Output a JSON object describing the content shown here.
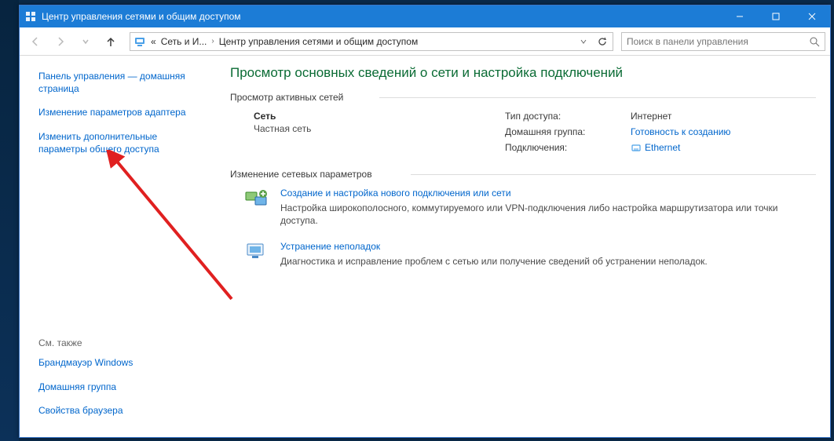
{
  "window": {
    "title": "Центр управления сетями и общим доступом"
  },
  "toolbar": {
    "breadcrumb": {
      "root": "«",
      "part1": "Сеть и И...",
      "part2": "Центр управления сетями и общим доступом"
    },
    "search_placeholder": "Поиск в панели управления"
  },
  "sidebar": {
    "home": "Панель управления — домашняя страница",
    "adapter": "Изменение параметров адаптера",
    "advanced": "Изменить дополнительные параметры общего доступа",
    "see_also": "См. также",
    "firewall": "Брандмауэр Windows",
    "homegroup": "Домашняя группа",
    "browser": "Свойства браузера"
  },
  "content": {
    "heading": "Просмотр основных сведений о сети и настройка подключений",
    "active_networks_label": "Просмотр активных сетей",
    "network": {
      "name": "Сеть",
      "type": "Частная сеть",
      "access_label": "Тип доступа:",
      "access_value": "Интернет",
      "homegroup_label": "Домашняя группа:",
      "homegroup_link": "Готовность к созданию",
      "connections_label": "Подключения:",
      "connections_link": "Ethernet"
    },
    "change_settings_label": "Изменение сетевых параметров",
    "task1": {
      "title": "Создание и настройка нового подключения или сети",
      "desc": "Настройка широкополосного, коммутируемого или VPN-подключения либо настройка маршрутизатора или точки доступа."
    },
    "task2": {
      "title": "Устранение неполадок",
      "desc": "Диагностика и исправление проблем с сетью или получение сведений об устранении неполадок."
    }
  }
}
